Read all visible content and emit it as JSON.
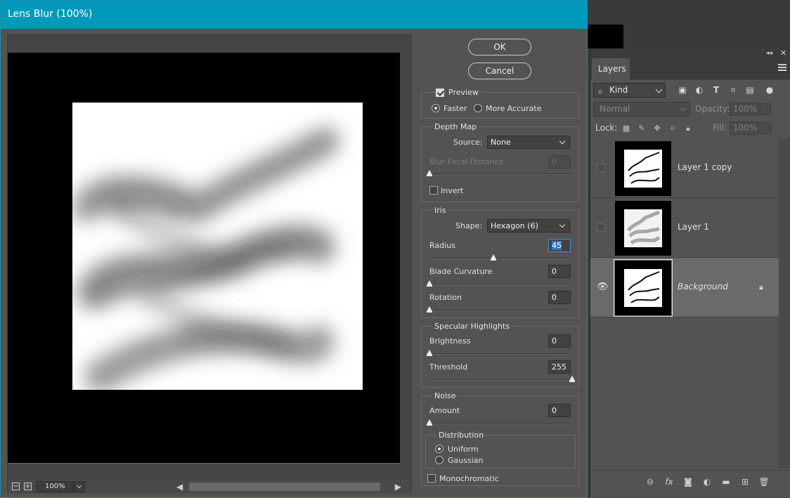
{
  "dialog": {
    "title": "Lens Blur (100%)",
    "ok_label": "OK",
    "cancel_label": "Cancel",
    "preview": {
      "label": "Preview",
      "checked": true,
      "faster_label": "Faster",
      "accurate_label": "More Accurate",
      "selected": "Faster"
    },
    "depth_map": {
      "title": "Depth Map",
      "source_label": "Source:",
      "source_value": "None",
      "blur_focal_label": "Blur Focal Distance",
      "blur_focal_value": "0",
      "invert_label": "Invert",
      "invert_checked": false
    },
    "iris": {
      "title": "Iris",
      "shape_label": "Shape:",
      "shape_value": "Hexagon (6)",
      "radius_label": "Radius",
      "radius_value": "45",
      "blade_label": "Blade Curvature",
      "blade_value": "0",
      "rotation_label": "Rotation",
      "rotation_value": "0"
    },
    "specular": {
      "title": "Specular Highlights",
      "brightness_label": "Brightness",
      "brightness_value": "0",
      "threshold_label": "Threshold",
      "threshold_value": "255"
    },
    "noise": {
      "title": "Noise",
      "amount_label": "Amount",
      "amount_value": "0",
      "distribution_title": "Distribution",
      "uniform_label": "Uniform",
      "gaussian_label": "Gaussian",
      "selected": "Uniform",
      "mono_label": "Monochromatic",
      "mono_checked": false
    },
    "zoom_value": "100%"
  },
  "layers_panel": {
    "tab_label": "Layers",
    "kind_label": "Kind",
    "blend_mode": "Normal",
    "opacity_label": "Opacity:",
    "opacity_value": "100%",
    "lock_label": "Lock:",
    "fill_label": "Fill:",
    "fill_value": "100%",
    "layers": [
      {
        "name": "Layer 1 copy",
        "visible": false,
        "selected": false
      },
      {
        "name": "Layer 1",
        "visible": false,
        "selected": false
      },
      {
        "name": "Background",
        "visible": true,
        "selected": true,
        "locked": true
      }
    ]
  },
  "colors": {
    "titlebar": "#0099bc",
    "panel": "#535353",
    "selected_layer": "#6a6a6a"
  }
}
